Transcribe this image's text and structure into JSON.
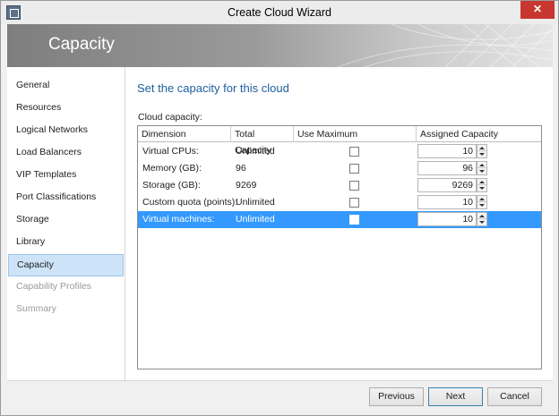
{
  "window": {
    "title": "Create Cloud Wizard",
    "close_label": "✕"
  },
  "banner": {
    "title": "Capacity"
  },
  "sidebar": {
    "items": [
      {
        "label": "General",
        "state": "normal"
      },
      {
        "label": "Resources",
        "state": "normal"
      },
      {
        "label": "Logical Networks",
        "state": "normal"
      },
      {
        "label": "Load Balancers",
        "state": "normal"
      },
      {
        "label": "VIP Templates",
        "state": "normal"
      },
      {
        "label": "Port Classifications",
        "state": "normal"
      },
      {
        "label": "Storage",
        "state": "normal"
      },
      {
        "label": "Library",
        "state": "normal"
      },
      {
        "label": "Capacity",
        "state": "selected"
      },
      {
        "label": "Capability Profiles",
        "state": "disabled"
      },
      {
        "label": "Summary",
        "state": "disabled"
      }
    ]
  },
  "main": {
    "heading": "Set the capacity for this cloud",
    "capacity_label": "Cloud capacity:",
    "table": {
      "columns": [
        "Dimension",
        "Total Capacity",
        "Use Maximum",
        "Assigned Capacity"
      ],
      "rows": [
        {
          "dimension": "Virtual CPUs:",
          "total": "Unlimited",
          "use_max": false,
          "assigned": "10",
          "selected": false
        },
        {
          "dimension": "Memory (GB):",
          "total": "96",
          "use_max": false,
          "assigned": "96",
          "selected": false
        },
        {
          "dimension": "Storage (GB):",
          "total": "9269",
          "use_max": false,
          "assigned": "9269",
          "selected": false
        },
        {
          "dimension": "Custom quota (points):",
          "total": "Unlimited",
          "use_max": false,
          "assigned": "10",
          "selected": false
        },
        {
          "dimension": "Virtual machines:",
          "total": "Unlimited",
          "use_max": false,
          "assigned": "10",
          "selected": true
        }
      ]
    }
  },
  "footer": {
    "previous_label": "Previous",
    "next_label": "Next",
    "cancel_label": "Cancel"
  },
  "colors": {
    "accent": "#1f5e9e",
    "selection": "#3399ff",
    "nav_selected": "#cde3f7",
    "close": "#c7372f"
  }
}
